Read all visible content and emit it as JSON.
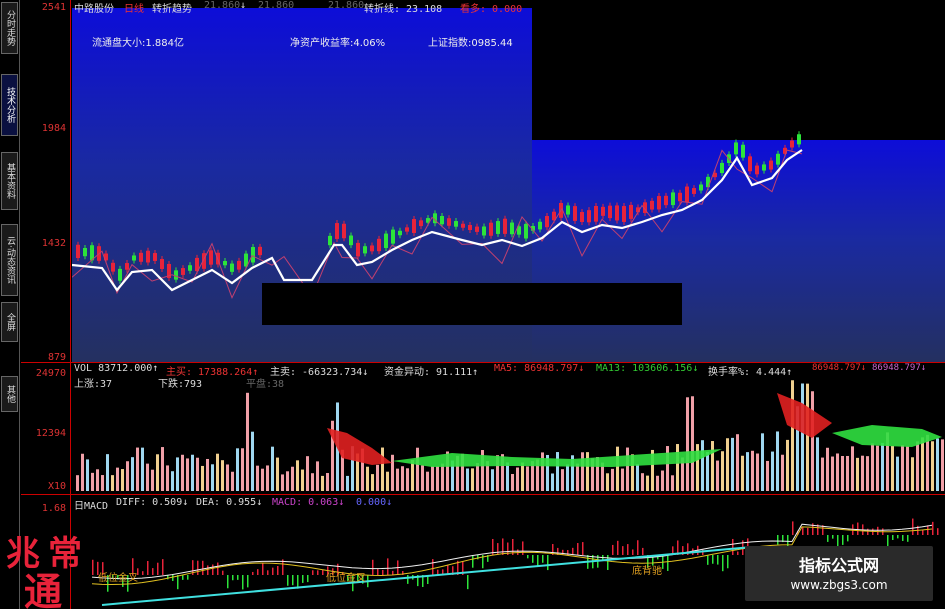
{
  "sidebar": {
    "tabs": [
      {
        "label": "分时走势"
      },
      {
        "label": "技术分析"
      },
      {
        "label": "基本资料"
      },
      {
        "label": "云·动态资讯"
      },
      {
        "label": "全屏"
      },
      {
        "label": "其他"
      }
    ]
  },
  "price_axis": {
    "labels": [
      "2541",
      "1984",
      "1432",
      "879"
    ]
  },
  "volume_axis": {
    "labels": [
      "24970",
      "12394",
      "X10"
    ]
  },
  "macd_axis": {
    "labels": [
      "1.68"
    ]
  },
  "header": {
    "stock_name": "中路股份",
    "period": "日线",
    "indicator": "转折趋势",
    "v1": "21.860",
    "v2": "21.860",
    "v3": "21.860",
    "turn_label": "转折线: 23.108",
    "watch": "看多: 0.000",
    "arrow_down": "↓"
  },
  "info": {
    "float_cap": "流通盘大小:1.884亿",
    "roe": "净资产收益率:4.06%",
    "index": "上证指数:0985.44"
  },
  "volume_header": {
    "vol": "VOL 83712.000↑",
    "active_buy": "主买: 17388.264↑",
    "active_sell": "主卖: -66323.734↓",
    "fund": "资金异动: 91.111↑",
    "ma5": "MA5: 86948.797↓",
    "ma13": "MA13: 103606.156↓",
    "turnover": "换手率%: 4.444↑",
    "ma_a": "86948.797↓",
    "ma_b": "86948.797↓"
  },
  "breadth": {
    "up": "上涨:37",
    "down": "下跌:793",
    "flat": "平盘:38"
  },
  "macd_header": {
    "name": "日MACD",
    "diff": "DIFF: 0.509↓",
    "dea": "DEA: 0.955↓",
    "macd": "MACD: 0.063↓",
    "extra": "0.000↓"
  },
  "annotations": {
    "low_golden": "低位金叉",
    "low_golden2": "低位金叉",
    "bottom": "底背驰"
  },
  "watermark": {
    "title": "指标公式网",
    "url": "www.zbgs3.com"
  },
  "seal": {
    "text": "兆常通"
  },
  "colors": {
    "up": "#e8233a",
    "down": "#2ce43a",
    "trend": "#ffffff",
    "axis": "#cc0000",
    "bg_top": "#1010d0",
    "bg_bottom": "#1e2a55"
  }
}
